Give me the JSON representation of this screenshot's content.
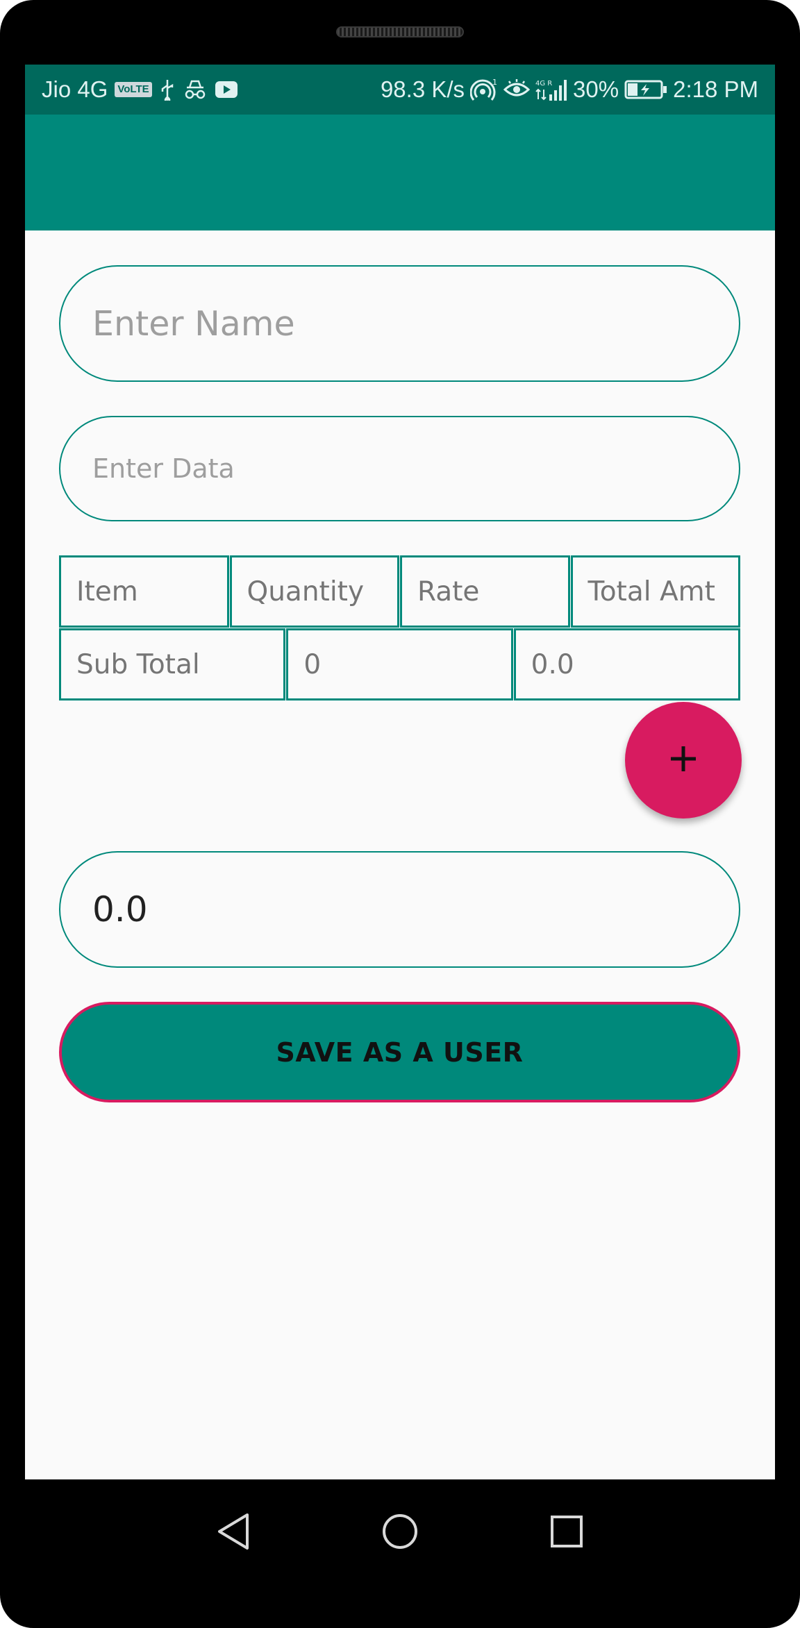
{
  "status_bar": {
    "carrier": "Jio 4G",
    "volte_badge": "VoLTE",
    "net_speed": "98.3 K/s",
    "battery": "30%",
    "time": "2:18 PM",
    "left_icons": [
      "volte-icon",
      "usb-icon",
      "incognito-icon",
      "youtube-icon"
    ],
    "right_icons": [
      "hotspot-icon",
      "eye-icon",
      "signal-4g-icon",
      "battery-charging-icon"
    ]
  },
  "form": {
    "name_placeholder": "Enter Name",
    "data_placeholder": "Enter Data",
    "total_value": "0.0"
  },
  "table": {
    "headers": [
      "Item",
      "Quantity",
      "Rate",
      "Total Amt"
    ],
    "subtotal": {
      "label": "Sub Total",
      "quantity": "0",
      "amount": "0.0"
    }
  },
  "fab": {
    "icon": "plus-icon"
  },
  "save_button": {
    "label": "SAVE AS A USER"
  },
  "nav": {
    "icons": [
      "back-icon",
      "home-icon",
      "recents-icon"
    ]
  },
  "colors": {
    "primary": "#00897b",
    "primary_dark": "#00695c",
    "accent": "#d81b60",
    "background": "#fafafa"
  }
}
